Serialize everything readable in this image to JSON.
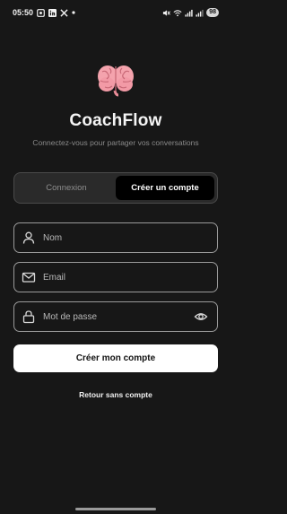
{
  "status_bar": {
    "time": "05:50",
    "battery": "98",
    "left_icons": [
      "screenshot-icon",
      "linkedin-icon",
      "x-icon",
      "dot-icon"
    ],
    "right_icons": [
      "mute-icon",
      "wifi-icon",
      "signal-icon",
      "signal-icon",
      "battery-icon"
    ]
  },
  "app": {
    "title": "CoachFlow",
    "subtitle": "Connectez-vous pour partager vos conversations"
  },
  "tabs": {
    "login_label": "Connexion",
    "signup_label": "Créer un compte",
    "active": "signup"
  },
  "form": {
    "name_placeholder": "Nom",
    "email_placeholder": "Email",
    "password_placeholder": "Mot de passe",
    "submit_label": "Créer mon compte"
  },
  "footer": {
    "back_label": "Retour sans compte"
  }
}
